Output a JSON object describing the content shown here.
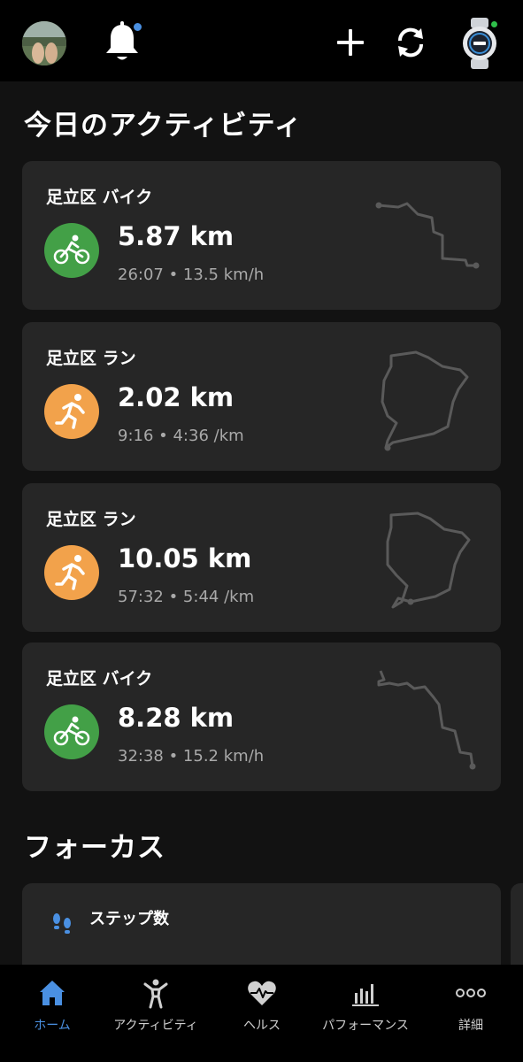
{
  "header": {
    "notification_badge_color": "#4a90e2",
    "device_status_color": "#2fbf4a"
  },
  "today": {
    "title": "今日のアクティビティ",
    "activities": [
      {
        "name": "足立区 バイク",
        "type": "bike-icon",
        "distance": "5.87 km",
        "stats": "26:07 • 13.5 km/h",
        "color": "#43a047"
      },
      {
        "name": "足立区 ラン",
        "type": "run-icon",
        "distance": "2.02 km",
        "stats": "9:16 • 4:36 /km",
        "color": "#f2a24b"
      },
      {
        "name": "足立区 ラン",
        "type": "run-icon",
        "distance": "10.05 km",
        "stats": "57:32 • 5:44 /km",
        "color": "#f2a24b"
      },
      {
        "name": "足立区 バイク",
        "type": "bike-icon",
        "distance": "8.28 km",
        "stats": "32:38 • 15.2 km/h",
        "color": "#43a047"
      }
    ]
  },
  "focus": {
    "title": "フォーカス",
    "card_label": "ステップ数"
  },
  "nav": {
    "items": [
      {
        "label": "ホーム",
        "icon": "home-icon",
        "active": true
      },
      {
        "label": "アクティビティ",
        "icon": "activity-person-icon",
        "active": false
      },
      {
        "label": "ヘルス",
        "icon": "heart-pulse-icon",
        "active": false
      },
      {
        "label": "パフォーマンス",
        "icon": "performance-bars-icon",
        "active": false
      },
      {
        "label": "詳細",
        "icon": "more-dots-icon",
        "active": false
      }
    ],
    "active_color": "#4a90e2"
  }
}
